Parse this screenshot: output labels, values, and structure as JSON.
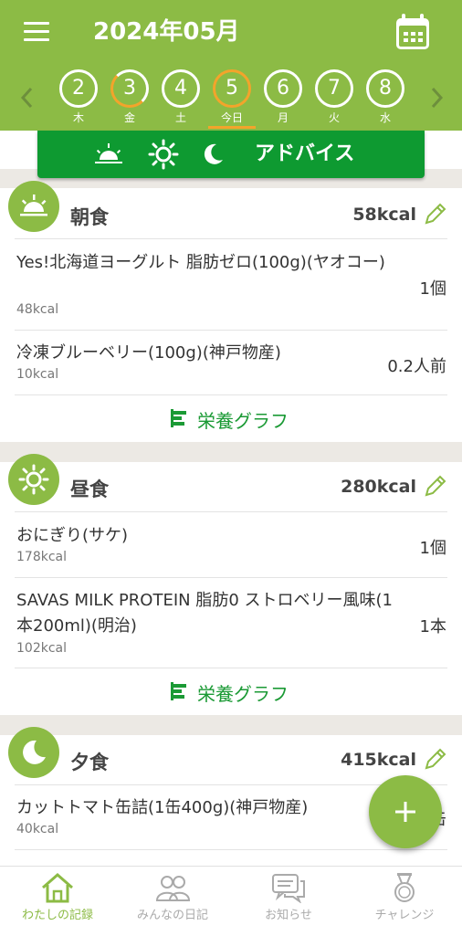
{
  "header": {
    "title": "2024年05月",
    "days": [
      {
        "num": "2",
        "weekday": "木"
      },
      {
        "num": "3",
        "weekday": "金"
      },
      {
        "num": "4",
        "weekday": "土"
      },
      {
        "num": "5",
        "weekday": "今日"
      },
      {
        "num": "6",
        "weekday": "月"
      },
      {
        "num": "7",
        "weekday": "火"
      },
      {
        "num": "8",
        "weekday": "水"
      }
    ],
    "colors": {
      "bar": "#8cbb45",
      "highlight": "#f3a42b"
    }
  },
  "advice": {
    "label": "アドバイス",
    "icons": [
      "sunrise-icon",
      "sun-icon",
      "moon-icon"
    ]
  },
  "meals": [
    {
      "title": "朝食",
      "kcal": "58kcal",
      "items": [
        {
          "name": "Yes!北海道ヨーグルト 脂肪ゼロ(100g)(ヤオコー)",
          "kcal": "48kcal",
          "qty": "1個"
        },
        {
          "name": "冷凍ブルーベリー(100g)(神戸物産)",
          "kcal": "10kcal",
          "qty": "0.2人前"
        }
      ],
      "graph_label": "栄養グラフ"
    },
    {
      "title": "昼食",
      "kcal": "280kcal",
      "items": [
        {
          "name": "おにぎり(サケ)",
          "kcal": "178kcal",
          "qty": "1個"
        },
        {
          "name": "SAVAS MILK PROTEIN 脂肪0 ストロベリー風味(1本200ml)(明治)",
          "kcal": "102kcal",
          "qty": "1本"
        }
      ],
      "graph_label": "栄養グラフ"
    },
    {
      "title": "夕食",
      "kcal": "415kcal",
      "items": [
        {
          "name": "カットトマト缶詰(1缶400g)(神戸物産)",
          "kcal": "40kcal",
          "qty": "1缶"
        }
      ]
    }
  ],
  "fab": {
    "icon": "plus-icon"
  },
  "bottom_nav": [
    {
      "label": "わたしの記録",
      "icon": "home-icon",
      "active": true
    },
    {
      "label": "みんなの日記",
      "icon": "people-icon",
      "active": false
    },
    {
      "label": "お知らせ",
      "icon": "chat-icon",
      "active": false
    },
    {
      "label": "チャレンジ",
      "icon": "medal-icon",
      "active": false
    }
  ]
}
